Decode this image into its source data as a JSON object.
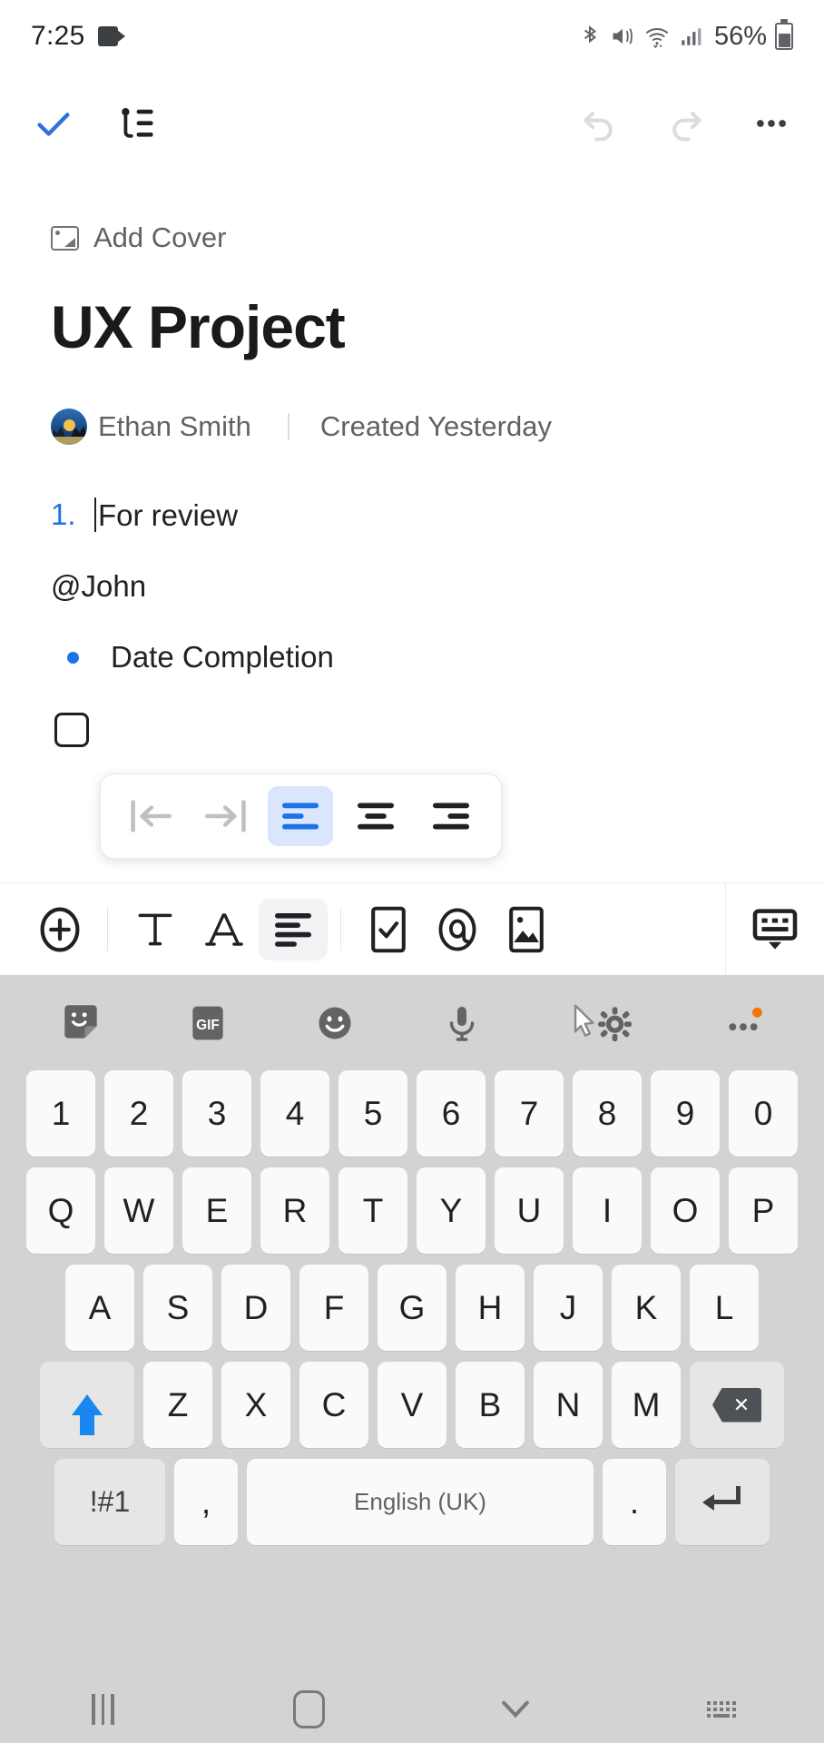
{
  "status_bar": {
    "time": "7:25",
    "battery_percent": "56%",
    "icons": [
      "screen-record-icon",
      "bluetooth-icon",
      "mute-vibrate-icon",
      "wifi-icon",
      "cellular-signal-icon",
      "battery-icon"
    ]
  },
  "app_bar": {
    "done_label": "done-check",
    "outline_label": "outline",
    "undo_label": "undo",
    "redo_label": "redo",
    "more_label": "more-options",
    "accent_color": "#2f6fe0",
    "disabled_color": "#dadce0"
  },
  "document": {
    "add_cover_label": "Add Cover",
    "title": "UX Project",
    "author": "Ethan Smith",
    "created": "Created Yesterday",
    "blocks": [
      {
        "type": "numbered",
        "marker": "1.",
        "text": "For review"
      },
      {
        "type": "paragraph",
        "text": "@John"
      },
      {
        "type": "bullet",
        "text": "Date Completion"
      },
      {
        "type": "checkbox",
        "text": "",
        "checked": false
      }
    ]
  },
  "align_popup": {
    "items": [
      {
        "name": "outdent",
        "label": "Outdent",
        "active": false
      },
      {
        "name": "indent",
        "label": "Indent",
        "active": false
      },
      {
        "name": "align-left",
        "label": "Align left",
        "active": true
      },
      {
        "name": "align-center",
        "label": "Align center",
        "active": false
      },
      {
        "name": "align-right",
        "label": "Align right",
        "active": false
      }
    ],
    "active_color": "#dbe6fd",
    "active_icon_color": "#1a73e8"
  },
  "editor_toolbar": {
    "items": [
      {
        "name": "add-block",
        "label": "Add",
        "active": false
      },
      {
        "name": "text-style",
        "label": "T",
        "active": false
      },
      {
        "name": "font-style",
        "label": "A",
        "active": false
      },
      {
        "name": "paragraph-align",
        "label": "Align",
        "active": true
      },
      {
        "name": "checkbox-insert",
        "label": "Checkbox",
        "active": false
      },
      {
        "name": "mention-insert",
        "label": "Mention",
        "active": false
      },
      {
        "name": "image-insert",
        "label": "Image",
        "active": false
      },
      {
        "name": "hide-keyboard",
        "label": "Hide keyboard",
        "active": false
      }
    ]
  },
  "keyboard": {
    "toolbar": [
      {
        "name": "sticker-icon",
        "label": "Sticker"
      },
      {
        "name": "gif-icon",
        "label": "GIF"
      },
      {
        "name": "emoji-icon",
        "label": "Emoji"
      },
      {
        "name": "microphone-icon",
        "label": "Voice input"
      },
      {
        "name": "settings-icon",
        "label": "Settings"
      },
      {
        "name": "overflow-icon",
        "label": "More",
        "badge": true
      }
    ],
    "badge_color": "#f2750a",
    "rows": {
      "numbers": [
        "1",
        "2",
        "3",
        "4",
        "5",
        "6",
        "7",
        "8",
        "9",
        "0"
      ],
      "top": [
        "Q",
        "W",
        "E",
        "R",
        "T",
        "Y",
        "U",
        "I",
        "O",
        "P"
      ],
      "home": [
        "A",
        "S",
        "D",
        "F",
        "G",
        "H",
        "J",
        "K",
        "L"
      ],
      "bottom": [
        "Z",
        "X",
        "C",
        "V",
        "B",
        "N",
        "M"
      ]
    },
    "shift_label": "shift",
    "backspace_label": "backspace",
    "symbols_label": "!#1",
    "comma_label": ",",
    "space_label": "English (UK)",
    "period_label": ".",
    "enter_label": "enter",
    "shift_color": "#1a87f0"
  },
  "nav_bar": {
    "items": [
      {
        "name": "recents-button",
        "label": "Recents"
      },
      {
        "name": "home-button",
        "label": "Home"
      },
      {
        "name": "back-button",
        "label": "Back"
      },
      {
        "name": "keyboard-switch-button",
        "label": "Switch keyboard"
      }
    ]
  }
}
